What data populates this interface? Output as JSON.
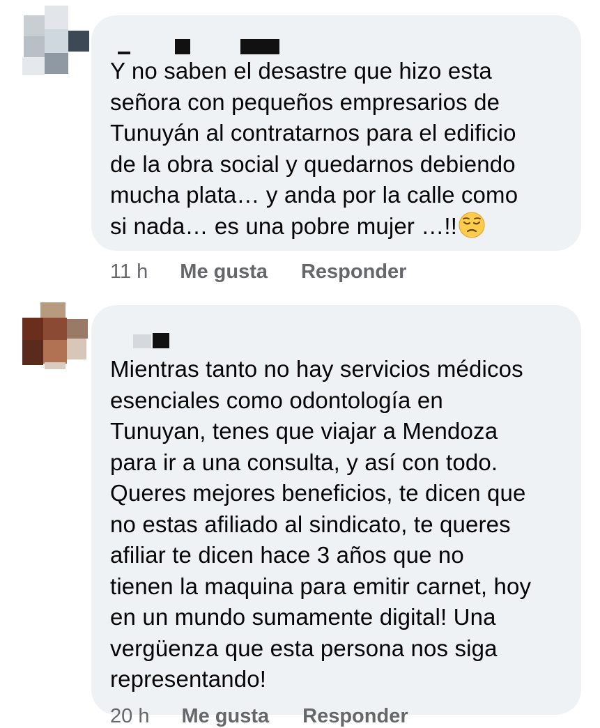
{
  "comments": [
    {
      "text": "Y no saben el desastre que hizo esta\nseñora con pequeños empresarios de\nTunuyán al contratarnos para el edificio\nde la obra social y quedarnos debiendo\nmucha plata… y anda por la calle como\nsi nada… es una pobre mujer …!!",
      "emoji": "pensive-face-emoji",
      "time": "11 h",
      "like_label": "Me gusta",
      "reply_label": "Responder"
    },
    {
      "text": "Mientras tanto no hay servicios médicos\nesenciales como odontología en\nTunuyan, tenes que viajar a Mendoza\npara ir a una consulta, y así con todo.\nQueres mejores beneficios, te dicen que\nno estas afiliado al sindicato, te queres\nafiliar te dicen hace 3 años que no\ntienen la maquina para emitir carnet, hoy\nen un mundo sumamente digital! Una\nvergüenza que esta persona nos siga\nrepresentando!",
      "time": "20 h",
      "like_label": "Me gusta",
      "reply_label": "Responder"
    }
  ],
  "colors": {
    "bubble": "#eff2f5",
    "text": "#050505",
    "meta": "#65676b"
  }
}
